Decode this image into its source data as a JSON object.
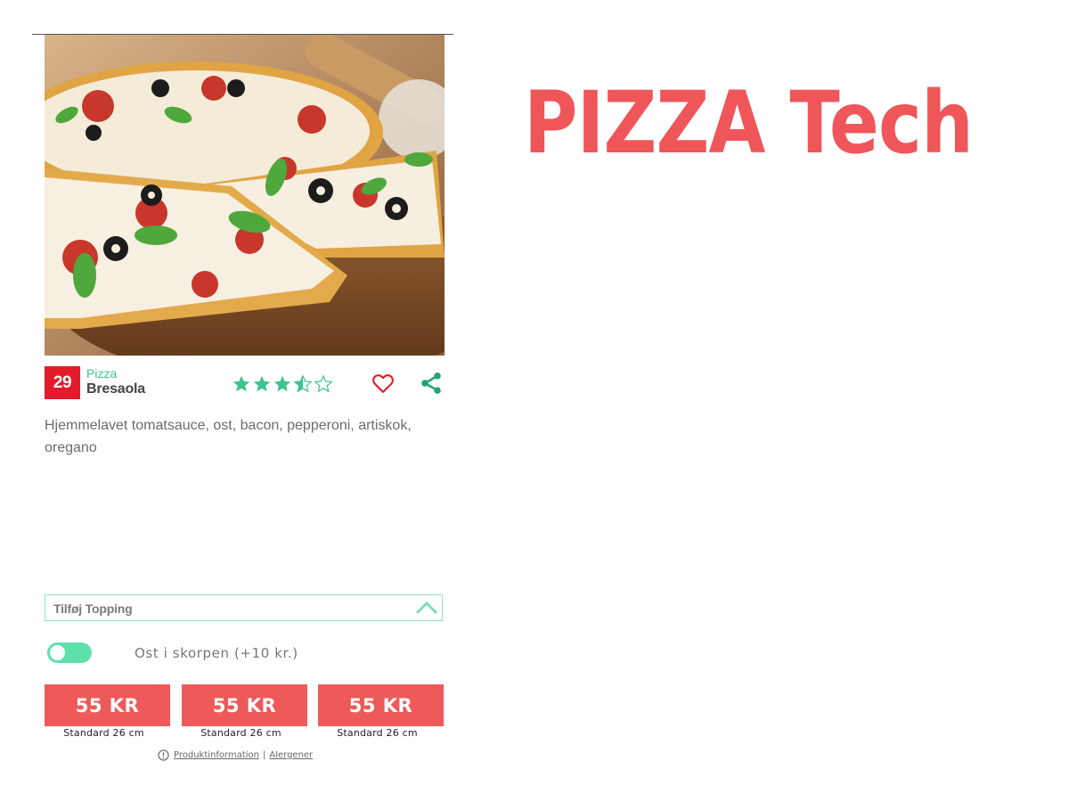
{
  "product": {
    "number": "29",
    "category": "Pizza",
    "name": "Bresaola",
    "rating": 3.5,
    "rating_max": 5,
    "description": "Hjemmelavet tomatsauce, ost, bacon, pepperoni, artiskok, oregano"
  },
  "icons": {
    "heart": "heart-icon",
    "share": "share-icon",
    "chevron": "chevron-up-icon",
    "info": "info-icon"
  },
  "topping": {
    "label": "Tilføj Topping"
  },
  "cheese_crust": {
    "label": "Ost i skorpen (+10 kr.)",
    "enabled": false
  },
  "sizes": [
    {
      "price": "55 KR",
      "label": "Standard 26 cm"
    },
    {
      "price": "55 KR",
      "label": "Standard 26 cm"
    },
    {
      "price": "55 KR",
      "label": "Standard 26 cm"
    }
  ],
  "footer": {
    "product_info": "Produktinformation",
    "separator": "|",
    "allergens": "Alergener"
  },
  "brand": {
    "title": "PIZZA Tech"
  },
  "colors": {
    "accent_red": "#ee5a5a",
    "badge_red": "#e21b2a",
    "green": "#3cc58a",
    "toggle_green": "#5fe0ab",
    "brand_red": "#ef5659"
  }
}
